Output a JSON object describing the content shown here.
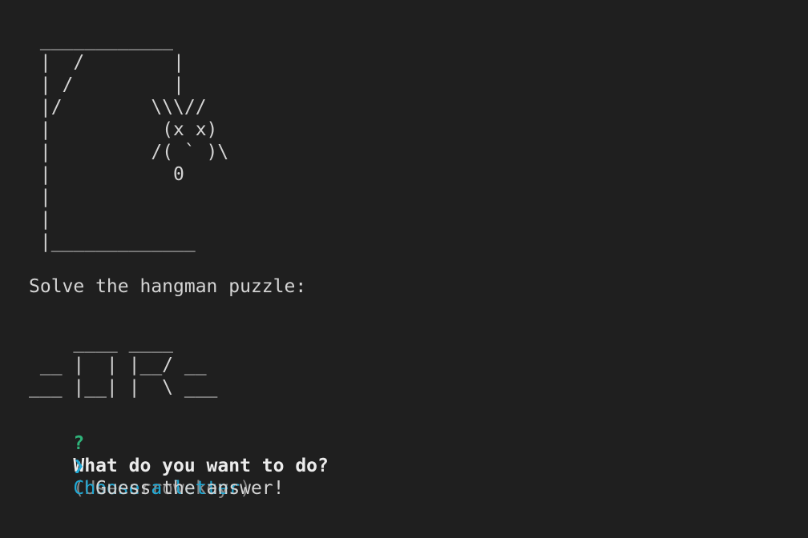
{
  "drawing": {
    "gallows_ascii": " ____________\n |  /        |\n | /         |\n |/        \\\\\\//\n |          (x x)\n |         /( ` )\\\n |           0\n |\n |\n |_____________"
  },
  "puzzle": {
    "heading": "Solve the hangman puzzle:",
    "word_ascii": "    ____ ____\n __ |  | |__/ __\n___ |__| |  \\ ___"
  },
  "prompt": {
    "mark": "?",
    "question": "What do you want to do?",
    "hint": "(Use arrow keys)",
    "pointer": "❯",
    "options": [
      {
        "label": "Choose a letter",
        "selected": true
      },
      {
        "label": "Guess the answer!",
        "selected": false
      }
    ]
  }
}
